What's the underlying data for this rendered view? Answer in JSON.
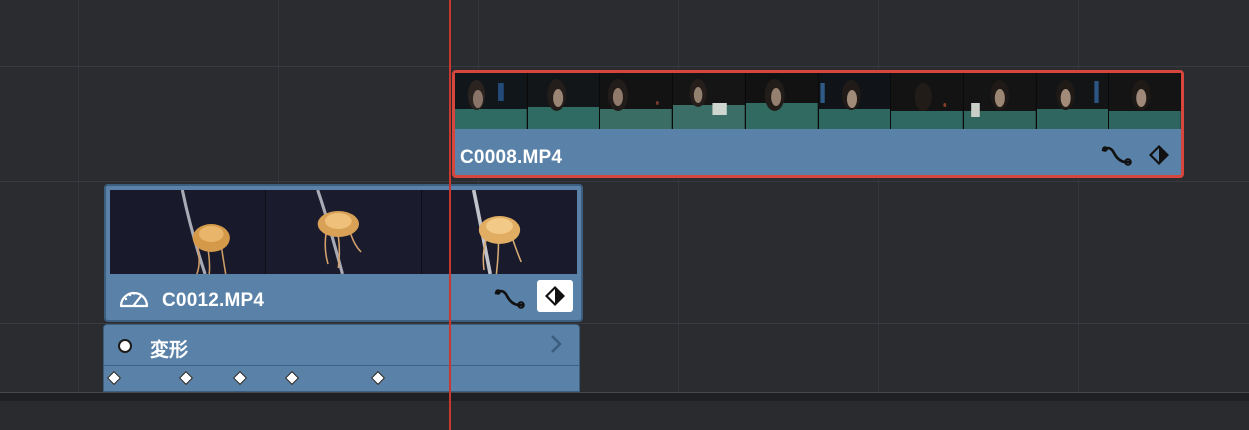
{
  "colors": {
    "background": "#2b2c30",
    "clip_blue": "#5a82a8",
    "selection_red": "#d7463c",
    "playhead_red": "#c8382e"
  },
  "clips": [
    {
      "name": "C0008.MP4",
      "selected": true,
      "icons": [
        "curve-icon",
        "keyframe-diamond-icon"
      ]
    },
    {
      "name": "C0012.MP4",
      "selected": false,
      "icons": [
        "speedometer-icon",
        "curve-icon",
        "keyframe-diamond-icon"
      ]
    }
  ],
  "keyframe_lane": {
    "label": "変形",
    "expand_icon": "chevron-right-icon",
    "keyframe_count": 5
  }
}
